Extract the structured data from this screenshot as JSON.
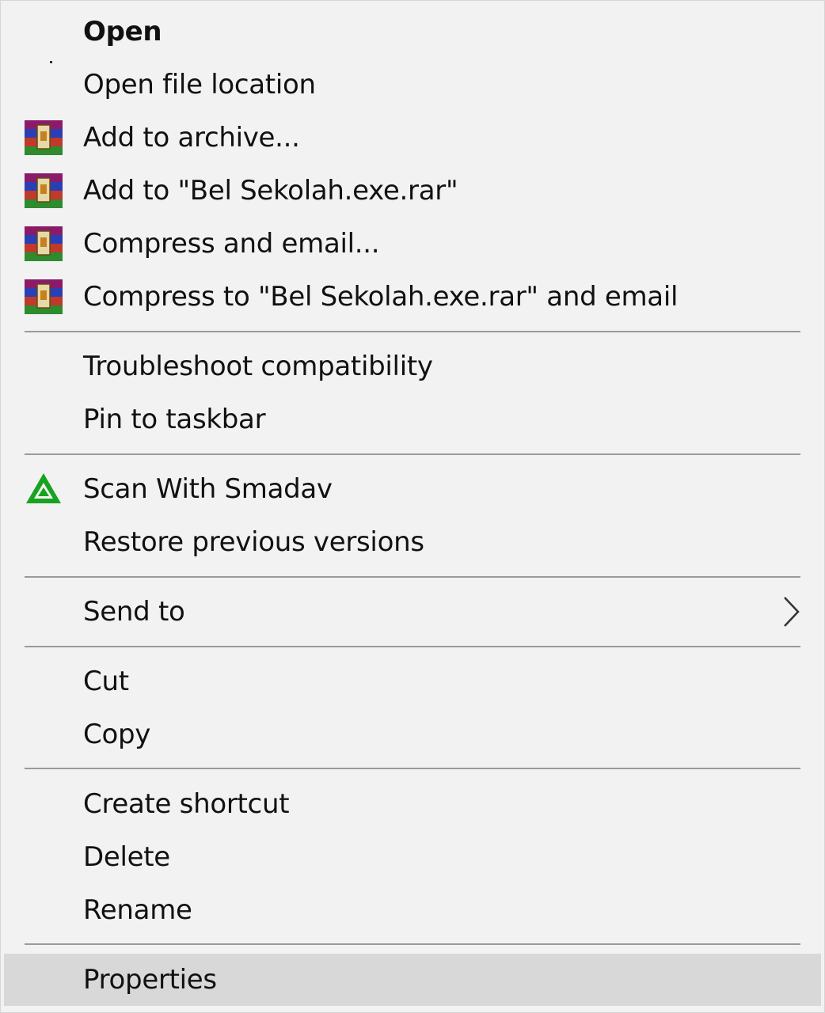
{
  "menu": {
    "items": [
      {
        "label": "Open"
      },
      {
        "label": "Open file location"
      },
      {
        "label": "Add to archive..."
      },
      {
        "label": "Add to \"Bel Sekolah.exe.rar\""
      },
      {
        "label": "Compress and email..."
      },
      {
        "label": "Compress to \"Bel Sekolah.exe.rar\" and email"
      },
      {
        "label": "Troubleshoot compatibility"
      },
      {
        "label": "Pin to taskbar"
      },
      {
        "label": "Scan With Smadav"
      },
      {
        "label": "Restore previous versions"
      },
      {
        "label": "Send to"
      },
      {
        "label": "Cut"
      },
      {
        "label": "Copy"
      },
      {
        "label": "Create shortcut"
      },
      {
        "label": "Delete"
      },
      {
        "label": "Rename"
      },
      {
        "label": "Properties"
      }
    ],
    "icons": {
      "winrar": "winrar-icon",
      "smadav": "smadav-icon",
      "submenu": "chevron-right-icon"
    },
    "highlighted": "Properties",
    "colors": {
      "background": "#f2f2f2",
      "highlight": "#d8d8d8",
      "separator": "#9a9a9a"
    }
  }
}
